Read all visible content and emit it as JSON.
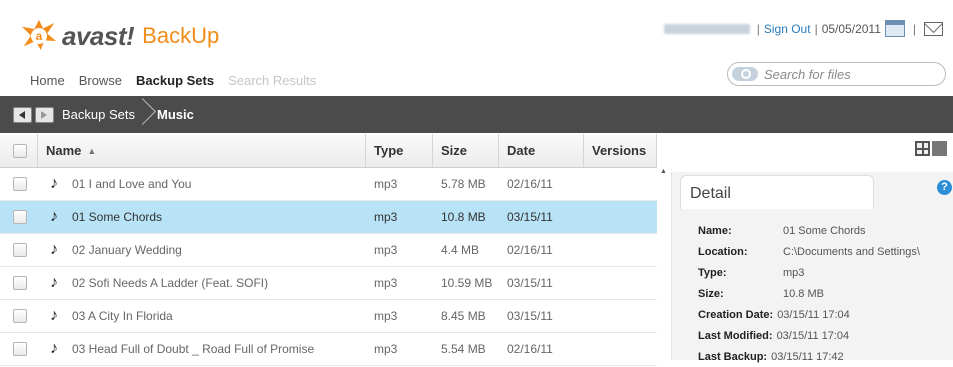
{
  "brand": {
    "name": "avast!",
    "product": "BackUp",
    "accent": "#f28c1a"
  },
  "topbar": {
    "sign_out": "Sign Out",
    "date": "05/05/2011"
  },
  "nav": [
    "Home",
    "Browse",
    "Backup Sets",
    "Search Results"
  ],
  "nav_active": "Backup Sets",
  "search": {
    "placeholder": "Search for files"
  },
  "breadcrumb": {
    "parent": "Backup Sets",
    "current": "Music"
  },
  "table": {
    "columns": [
      "Name",
      "Type",
      "Size",
      "Date",
      "Versions"
    ],
    "sort": "Name ascending",
    "rows": [
      {
        "name": "01 I and Love and You",
        "type": "mp3",
        "size": "5.78 MB",
        "date": "02/16/11",
        "versions": ""
      },
      {
        "name": "01 Some Chords",
        "type": "mp3",
        "size": "10.8 MB",
        "date": "03/15/11",
        "versions": "",
        "selected": true
      },
      {
        "name": "02 January Wedding",
        "type": "mp3",
        "size": "4.4 MB",
        "date": "02/16/11",
        "versions": ""
      },
      {
        "name": "02 Sofi Needs A Ladder (Feat. SOFI)",
        "type": "mp3",
        "size": "10.59 MB",
        "date": "03/15/11",
        "versions": ""
      },
      {
        "name": "03 A City In Florida",
        "type": "mp3",
        "size": "8.45 MB",
        "date": "03/15/11",
        "versions": ""
      },
      {
        "name": "03 Head Full of Doubt _ Road Full of Promise",
        "type": "mp3",
        "size": "5.54 MB",
        "date": "02/16/11",
        "versions": ""
      }
    ]
  },
  "detail": {
    "title": "Detail",
    "name_label": "Name:",
    "name": "01 Some Chords",
    "location_label": "Location:",
    "location": "C:\\Documents and Settings\\",
    "type_label": "Type:",
    "type": "mp3",
    "size_label": "Size:",
    "size": "10.8 MB",
    "created_label": "Creation Date:",
    "created": "03/15/11 17:04",
    "modified_label": "Last Modified:",
    "modified": "03/15/11 17:04",
    "backup_label": "Last Backup:",
    "backup": "03/15/11 17:42"
  }
}
